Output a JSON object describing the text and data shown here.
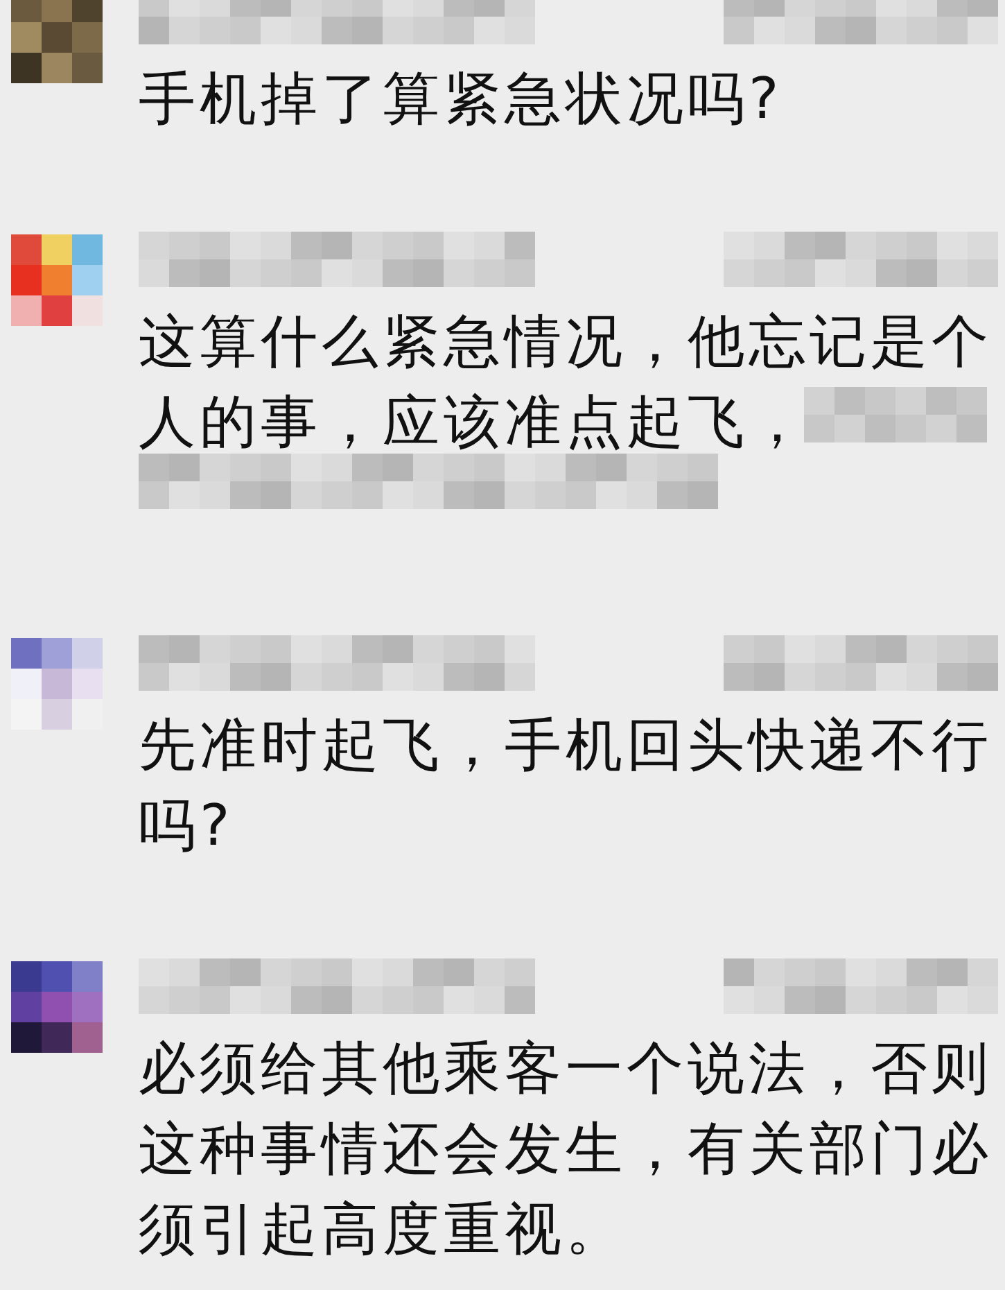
{
  "comments": [
    {
      "text": "手机掉了算紧急状况吗?",
      "redacted_tail": false
    },
    {
      "text": "这算什么紧急情况，他忘记是个人的事，应该准点起飞，",
      "redacted_tail": true
    },
    {
      "text": "先准时起飞，手机回头快递不行吗?",
      "redacted_tail": false
    },
    {
      "text": "必须给其他乘客一个说法，否则这种事情还会发生，有关部门必须引起高度重视。",
      "redacted_tail": false
    }
  ]
}
